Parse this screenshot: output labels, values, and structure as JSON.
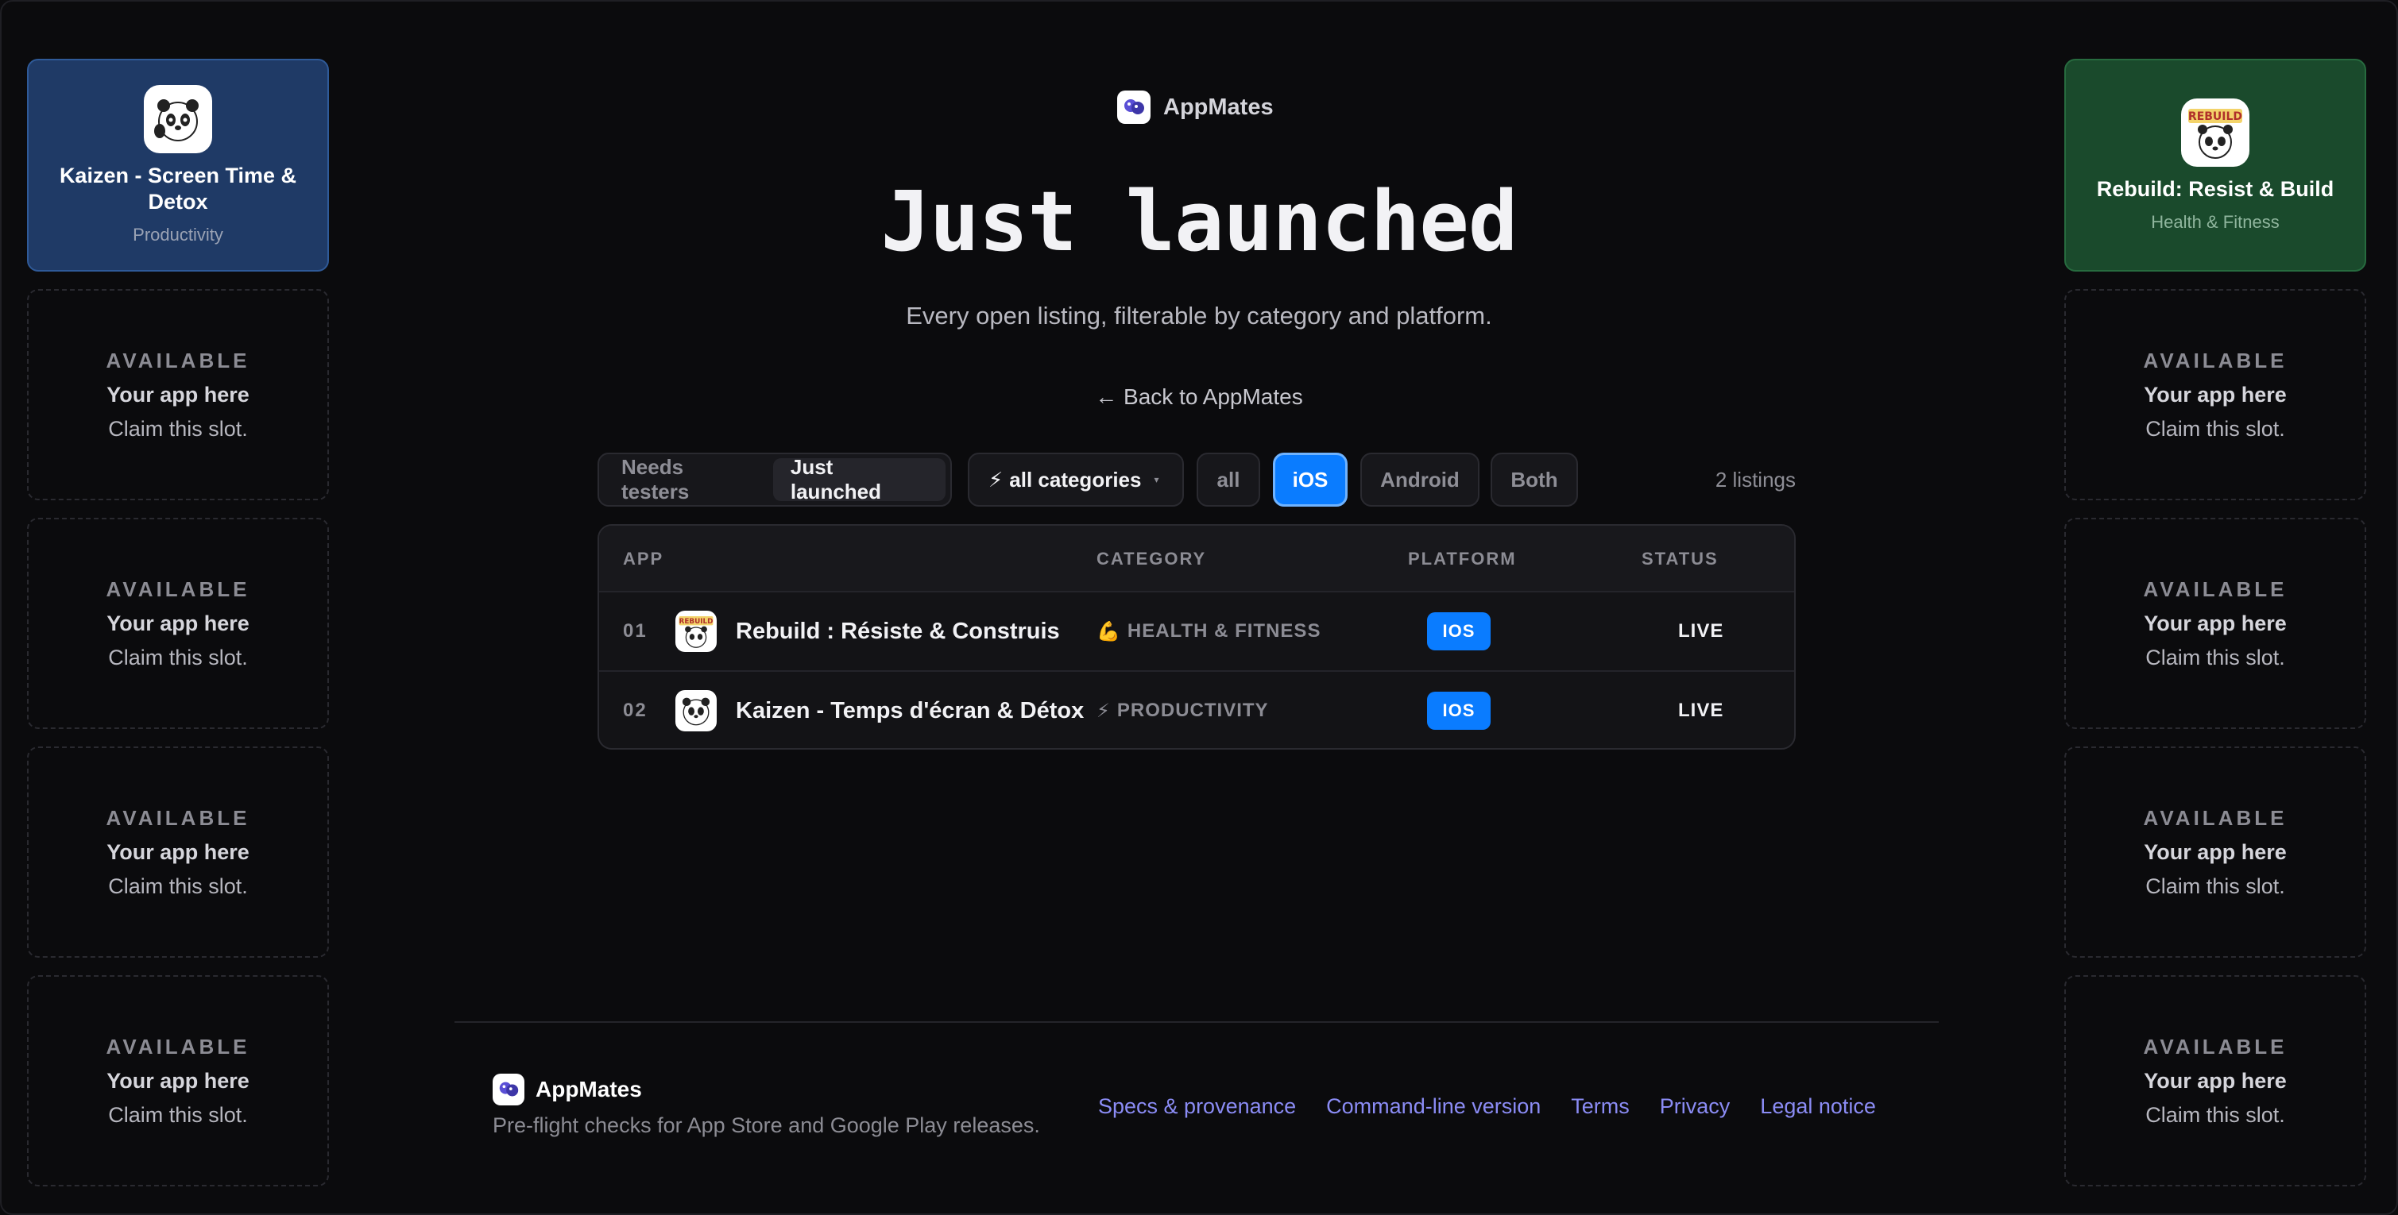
{
  "brand": {
    "name": "AppMates"
  },
  "hero": {
    "title": "Just launched",
    "subtitle": "Every open listing, filterable by category and platform.",
    "back_link": "← Back to AppMates"
  },
  "left_rail": {
    "featured": {
      "name": "Kaizen - Screen Time & Detox",
      "category": "Productivity"
    },
    "slots": [
      {
        "label": "AVAILABLE",
        "title": "Your app here",
        "cta": "Claim this slot."
      },
      {
        "label": "AVAILABLE",
        "title": "Your app here",
        "cta": "Claim this slot."
      },
      {
        "label": "AVAILABLE",
        "title": "Your app here",
        "cta": "Claim this slot."
      },
      {
        "label": "AVAILABLE",
        "title": "Your app here",
        "cta": "Claim this slot."
      }
    ]
  },
  "right_rail": {
    "featured": {
      "name": "Rebuild: Resist & Build",
      "category": "Health & Fitness"
    },
    "slots": [
      {
        "label": "AVAILABLE",
        "title": "Your app here",
        "cta": "Claim this slot."
      },
      {
        "label": "AVAILABLE",
        "title": "Your app here",
        "cta": "Claim this slot."
      },
      {
        "label": "AVAILABLE",
        "title": "Your app here",
        "cta": "Claim this slot."
      },
      {
        "label": "AVAILABLE",
        "title": "Your app here",
        "cta": "Claim this slot."
      }
    ]
  },
  "filters": {
    "modes": [
      "Needs testers",
      "Just launched"
    ],
    "active_mode": "Just launched",
    "category_dropdown": {
      "icon": "⚡",
      "label": "all categories",
      "caret": "▾"
    },
    "platforms": [
      "all",
      "iOS",
      "Android",
      "Both"
    ],
    "active_platform": "iOS",
    "count_label": "2 listings"
  },
  "table": {
    "headers": {
      "app": "APP",
      "category": "CATEGORY",
      "platform": "PLATFORM",
      "status": "STATUS"
    },
    "rows": [
      {
        "rank": "01",
        "name": "Rebuild : Résiste & Construis",
        "category_icon": "💪",
        "category": "HEALTH & FITNESS",
        "platform": "IOS",
        "status": "LIVE"
      },
      {
        "rank": "02",
        "name": "Kaizen - Temps d'écran & Détox",
        "category_icon": "⚡",
        "category": "PRODUCTIVITY",
        "platform": "IOS",
        "status": "LIVE"
      }
    ]
  },
  "footer": {
    "brand": "AppMates",
    "tagline": "Pre-flight checks for App Store and Google Play releases.",
    "links": [
      "Specs & provenance",
      "Command-line version",
      "Terms",
      "Privacy",
      "Legal notice"
    ]
  },
  "colors": {
    "background": "#0b0b0d",
    "accent_blue": "#0a7cff",
    "link_purple": "#8b8cf5",
    "featured_blue": "#1f3a66",
    "featured_green": "#1a4a2c"
  }
}
